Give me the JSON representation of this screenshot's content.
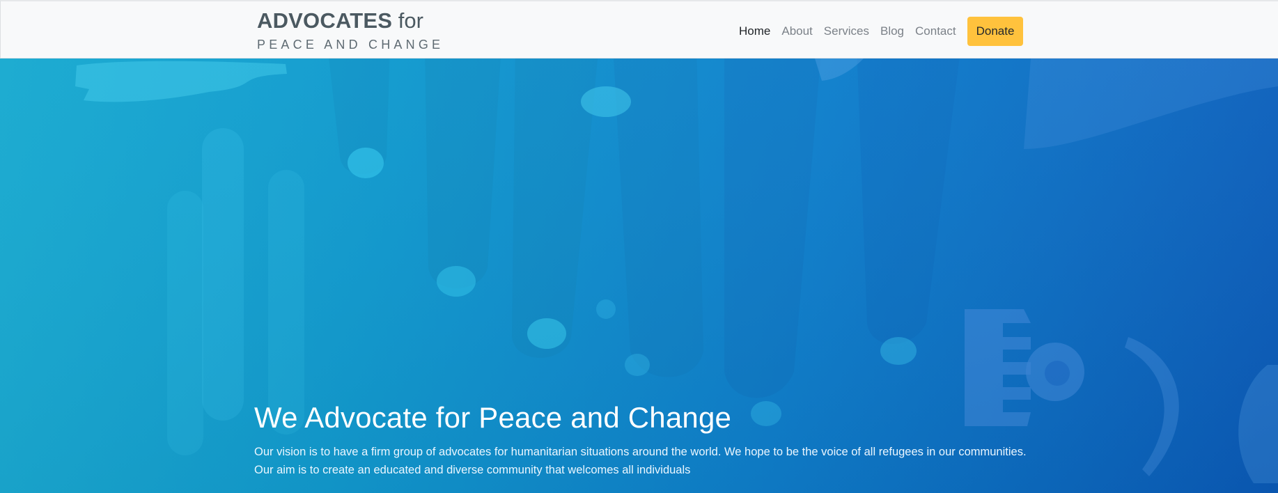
{
  "brand": {
    "name_strong": "ADVOCATES",
    "name_for": "for",
    "tagline": "PEACE AND CHANGE"
  },
  "nav": {
    "items": [
      {
        "label": "Home",
        "active": true
      },
      {
        "label": "About",
        "active": false
      },
      {
        "label": "Services",
        "active": false
      },
      {
        "label": "Blog",
        "active": false
      },
      {
        "label": "Contact",
        "active": false
      }
    ],
    "donate_label": "Donate"
  },
  "hero": {
    "title": "We Advocate for Peace and Change",
    "text": "Our vision is to have a firm group of advocates for humanitarian situations around the world. We hope to be the voice of all refugees in our communities. Our aim is to create an educated and diverse community that welcomes all individuals"
  },
  "colors": {
    "accent": "#ffc23d",
    "hero_start": "#12a8cf",
    "hero_end": "#0b5fc2",
    "brand_text": "#4b5961"
  }
}
